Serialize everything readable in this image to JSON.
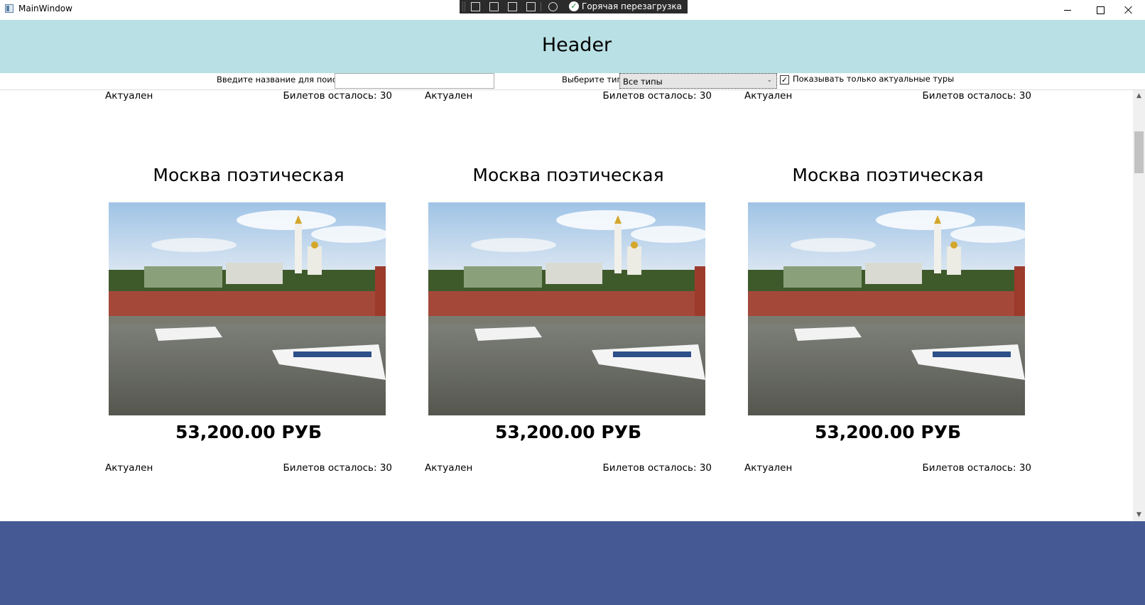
{
  "window": {
    "title": "MainWindow"
  },
  "debug_toolbar": {
    "hot_reload_label": "Горячая перезагрузка"
  },
  "header": {
    "title": "Header"
  },
  "filters": {
    "search_label": "Введите название для поиска:",
    "search_value": "",
    "type_label": "Выберите тип:",
    "type_selected": "Все типы",
    "only_actual_label": "Показывать только актуальные туры",
    "only_actual_checked": true
  },
  "partial_row": [
    {
      "status": "Актуален",
      "tickets": "Билетов осталось: 30"
    },
    {
      "status": "Актуален",
      "tickets": "Билетов осталось: 30"
    },
    {
      "status": "Актуален",
      "tickets": "Билетов осталось: 30"
    }
  ],
  "tours": [
    {
      "name": "Москва поэтическая",
      "price": "53,200.00 РУБ",
      "status": "Актуален",
      "tickets": "Билетов осталось: 30"
    },
    {
      "name": "Москва поэтическая",
      "price": "53,200.00 РУБ",
      "status": "Актуален",
      "tickets": "Билетов осталось: 30"
    },
    {
      "name": "Москва поэтическая",
      "price": "53,200.00 РУБ",
      "status": "Актуален",
      "tickets": "Билетов осталось: 30"
    }
  ],
  "colors": {
    "header_bg": "#b9e1e5",
    "footer_bg": "#455a94"
  },
  "scroll": {
    "position_fraction": 0.1
  }
}
